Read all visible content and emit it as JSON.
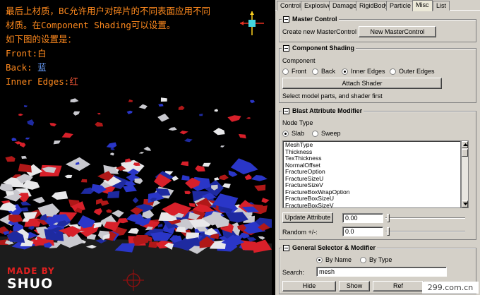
{
  "overlay": {
    "line1": "最后上材质，BC允许用户对碎片的不同表面应用不同",
    "line2": "材质。在Component Shading可以设置。",
    "line3": "如下图的设置是：",
    "front_label": "Front:",
    "front_value": "白",
    "back_label": "Back: ",
    "back_value": "蓝",
    "inner_label": "Inner Edges:",
    "inner_value": "红"
  },
  "logo": {
    "madeby": "MADE BY",
    "name": "SHUO"
  },
  "tabs": [
    "Control",
    "Explosive",
    "Damage",
    "RigidBody",
    "Particle",
    "Misc",
    "List"
  ],
  "active_tab": "Misc",
  "master_control": {
    "title": "Master Control",
    "label": "Create new MasterControl",
    "button": "New MasterControl"
  },
  "component_shading": {
    "title": "Component Shading",
    "component_label": "Component",
    "options": [
      "Front",
      "Back",
      "Inner Edges",
      "Outer Edges"
    ],
    "selected": "Inner Edges",
    "attach_button": "Attach Shader",
    "hint": "Select model parts, and shader first"
  },
  "blast_attribute": {
    "title": "Blast Attribute Modifier",
    "node_type_label": "Node Type",
    "node_types": [
      "Slab",
      "Sweep"
    ],
    "selected": "Slab",
    "attributes": [
      "MeshType",
      "Thickness",
      "TexThickness",
      "NormalOffset",
      "FractureOption",
      "FractureSizeU",
      "FractureSizeV",
      "FractureBoxWrapOption",
      "FractureBoxSizeU",
      "FractureBoxSizeV"
    ],
    "update_button": "Update Attribute",
    "update_value": "0.00",
    "random_label": "Random +/-:",
    "random_value": "0.0"
  },
  "general_selector": {
    "title": "General Selector & Modifier",
    "modes": [
      "By Name",
      "By Type"
    ],
    "selected": "By Name",
    "search_label": "Search:",
    "search_value": "mesh",
    "buttons": {
      "hide": "Hide",
      "show": "Show",
      "ref": "Ref"
    }
  },
  "watermark": "299.com.cn",
  "colors": {
    "text_orange": "#ff8a1e",
    "back_blue": "#6aa0ff",
    "inner_red": "#ff5a3a",
    "panel_bg": "#d4d0c8"
  }
}
